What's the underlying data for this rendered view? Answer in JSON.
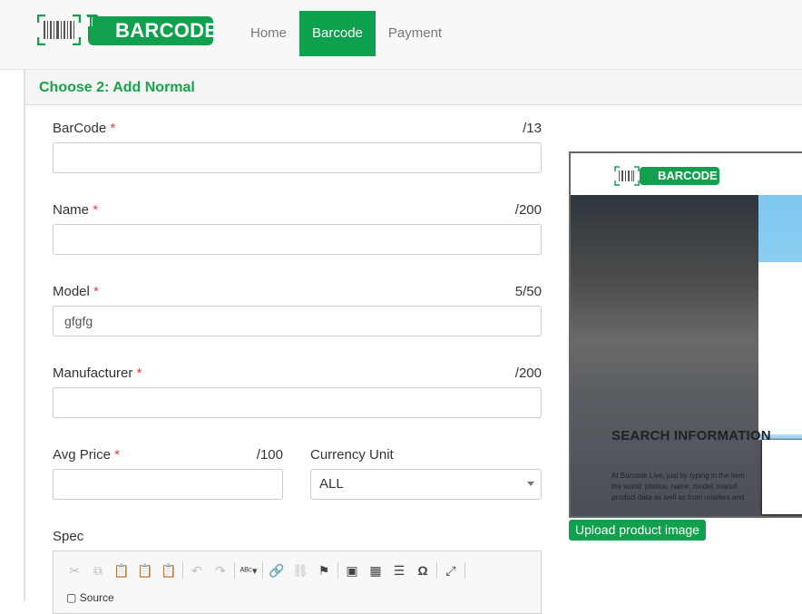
{
  "header": {
    "logo_text": "BARCODE",
    "nav": [
      "Home",
      "Barcode",
      "Payment"
    ],
    "active_nav": "Barcode"
  },
  "panel": {
    "title": "Choose 2: Add Normal"
  },
  "form": {
    "barcode": {
      "label": "BarCode",
      "required": "*",
      "counter": "/13",
      "value": ""
    },
    "name": {
      "label": "Name",
      "required": "*",
      "counter": "/200",
      "value": ""
    },
    "model": {
      "label": "Model",
      "required": "*",
      "counter": "5/50",
      "value": "gfgfg"
    },
    "manufacturer": {
      "label": "Manufacturer",
      "required": "*",
      "counter": "/200",
      "value": ""
    },
    "avg_price": {
      "label": "Avg Price",
      "required": "*",
      "counter": "/100",
      "value": ""
    },
    "currency": {
      "label": "Currency Unit",
      "selected": "ALL"
    },
    "spec": {
      "label": "Spec",
      "source_label": "Source"
    }
  },
  "editor_toolbar": [
    "cut-icon",
    "copy-icon",
    "paste-icon",
    "paste-text-icon",
    "paste-word-icon",
    "undo-icon",
    "redo-icon",
    "spellcheck-icon",
    "link-icon",
    "unlink-icon",
    "anchor-icon",
    "image-icon",
    "table-icon",
    "horizontal-line-icon",
    "special-char-icon",
    "maximize-icon"
  ],
  "preview": {
    "logo_text": "BARCODE",
    "heading": "SEARCH INFORMATION",
    "body": "At Barcode Live, just by typing in the item the world: photos, name, model, manuf product data as well as from retailers and",
    "upload_label": "Upload product image"
  },
  "colors": {
    "brand_green": "#11a04e",
    "required_red": "#e53e3e"
  }
}
